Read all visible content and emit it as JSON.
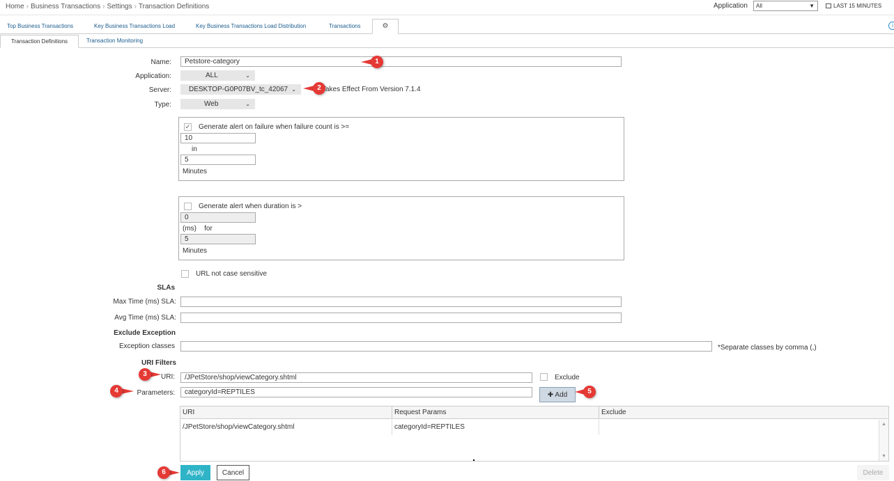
{
  "breadcrumb": [
    "Home",
    "Business Transactions",
    "Settings",
    "Transaction Definitions"
  ],
  "header": {
    "application_label": "Application",
    "application_value": "All",
    "time_range": "LAST 15 MINUTES"
  },
  "tabs": [
    {
      "label": "Top Business Transactions"
    },
    {
      "label": "Key Business Transactions Load"
    },
    {
      "label": "Key Business Transactions Load Distribution"
    },
    {
      "label": "Transactions"
    }
  ],
  "subtabs": [
    {
      "label": "Transaction Definitions"
    },
    {
      "label": "Transaction Monitoring"
    }
  ],
  "form": {
    "name_label": "Name:",
    "name_value": "Petstore-category",
    "application_label": "Application:",
    "application_value": "ALL",
    "server_label": "Server:",
    "server_value": "DESKTOP-G0P07BV_tc_42067",
    "server_note": "Takes Effect From Version 7.1.4",
    "type_label": "Type:",
    "type_value": "Web",
    "failure_alert": {
      "label": "Generate alert on failure when failure count is >=",
      "checked": true,
      "count": "10",
      "in_label": "in",
      "minutes": "5",
      "minutes_label": "Minutes"
    },
    "duration_alert": {
      "label": "Generate alert when duration is >",
      "checked": false,
      "duration": "0",
      "ms_for_label": "(ms)    for",
      "minutes": "5",
      "minutes_label": "Minutes"
    },
    "url_case_label": "URL not case sensitive",
    "slas_heading": "SLAs",
    "max_sla_label": "Max Time (ms) SLA:",
    "avg_sla_label": "Avg Time (ms) SLA:",
    "exclude_exception_heading": "Exclude Exception",
    "exception_classes_label": "Exception classes",
    "exception_note": "*Separate classes by comma (,)",
    "uri_filters_heading": "URI Filters",
    "uri_label": "URI:",
    "uri_value": "/JPetStore/shop/viewCategory.shtml",
    "exclude_label": "Exclude",
    "parameters_label": "Parameters:",
    "parameters_value": "categoryId=REPTILES",
    "add_label": "Add"
  },
  "grid": {
    "headers": [
      "URI",
      "Request Params",
      "Exclude"
    ],
    "rows": [
      {
        "uri": "/JPetStore/shop/viewCategory.shtml",
        "params": "categoryId=REPTILES",
        "exclude": ""
      }
    ]
  },
  "buttons": {
    "apply": "Apply",
    "cancel": "Cancel",
    "delete": "Delete"
  },
  "badges": [
    "1",
    "2",
    "3",
    "4",
    "5",
    "6"
  ],
  "colors": {
    "badge": "#e53935",
    "apply": "#2fb4c7",
    "link": "#1a5c8f"
  }
}
